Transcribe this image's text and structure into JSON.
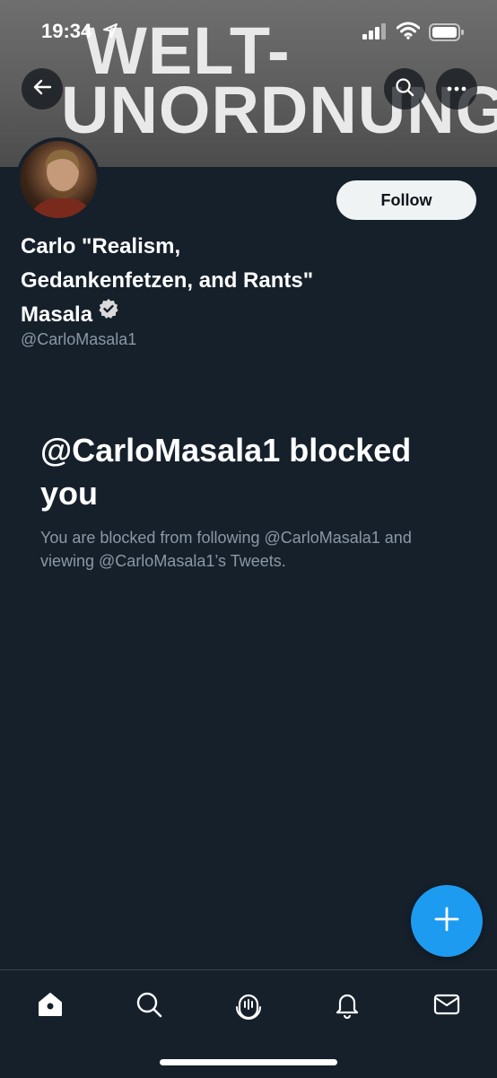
{
  "status_bar": {
    "time": "19:34"
  },
  "banner": {
    "line1": "WELT-",
    "line2": "UNORDNUNG"
  },
  "profile": {
    "name_line1": "Carlo \"Realism,",
    "name_line2": "Gedankenfetzen, and Rants\"",
    "name_line3": "Masala",
    "handle": "@CarloMasala1",
    "follow_label": "Follow"
  },
  "blocked": {
    "title": "@CarloMasala1 blocked you",
    "description": "You are blocked from following @CarloMasala1 and viewing @CarloMasala1’s Tweets."
  },
  "icons": {
    "back": "arrow-left-icon",
    "search": "search-icon",
    "more": "more-horizontal-icon",
    "verified": "verified-badge-icon",
    "compose": "plus-icon",
    "tabs": [
      "home-icon",
      "search-icon",
      "spaces-icon",
      "bell-icon",
      "mail-icon"
    ]
  },
  "colors": {
    "background": "#15202b",
    "accent": "#1d9bf0",
    "secondary_text": "#8b98a5",
    "follow_button": "#eff3f4"
  }
}
